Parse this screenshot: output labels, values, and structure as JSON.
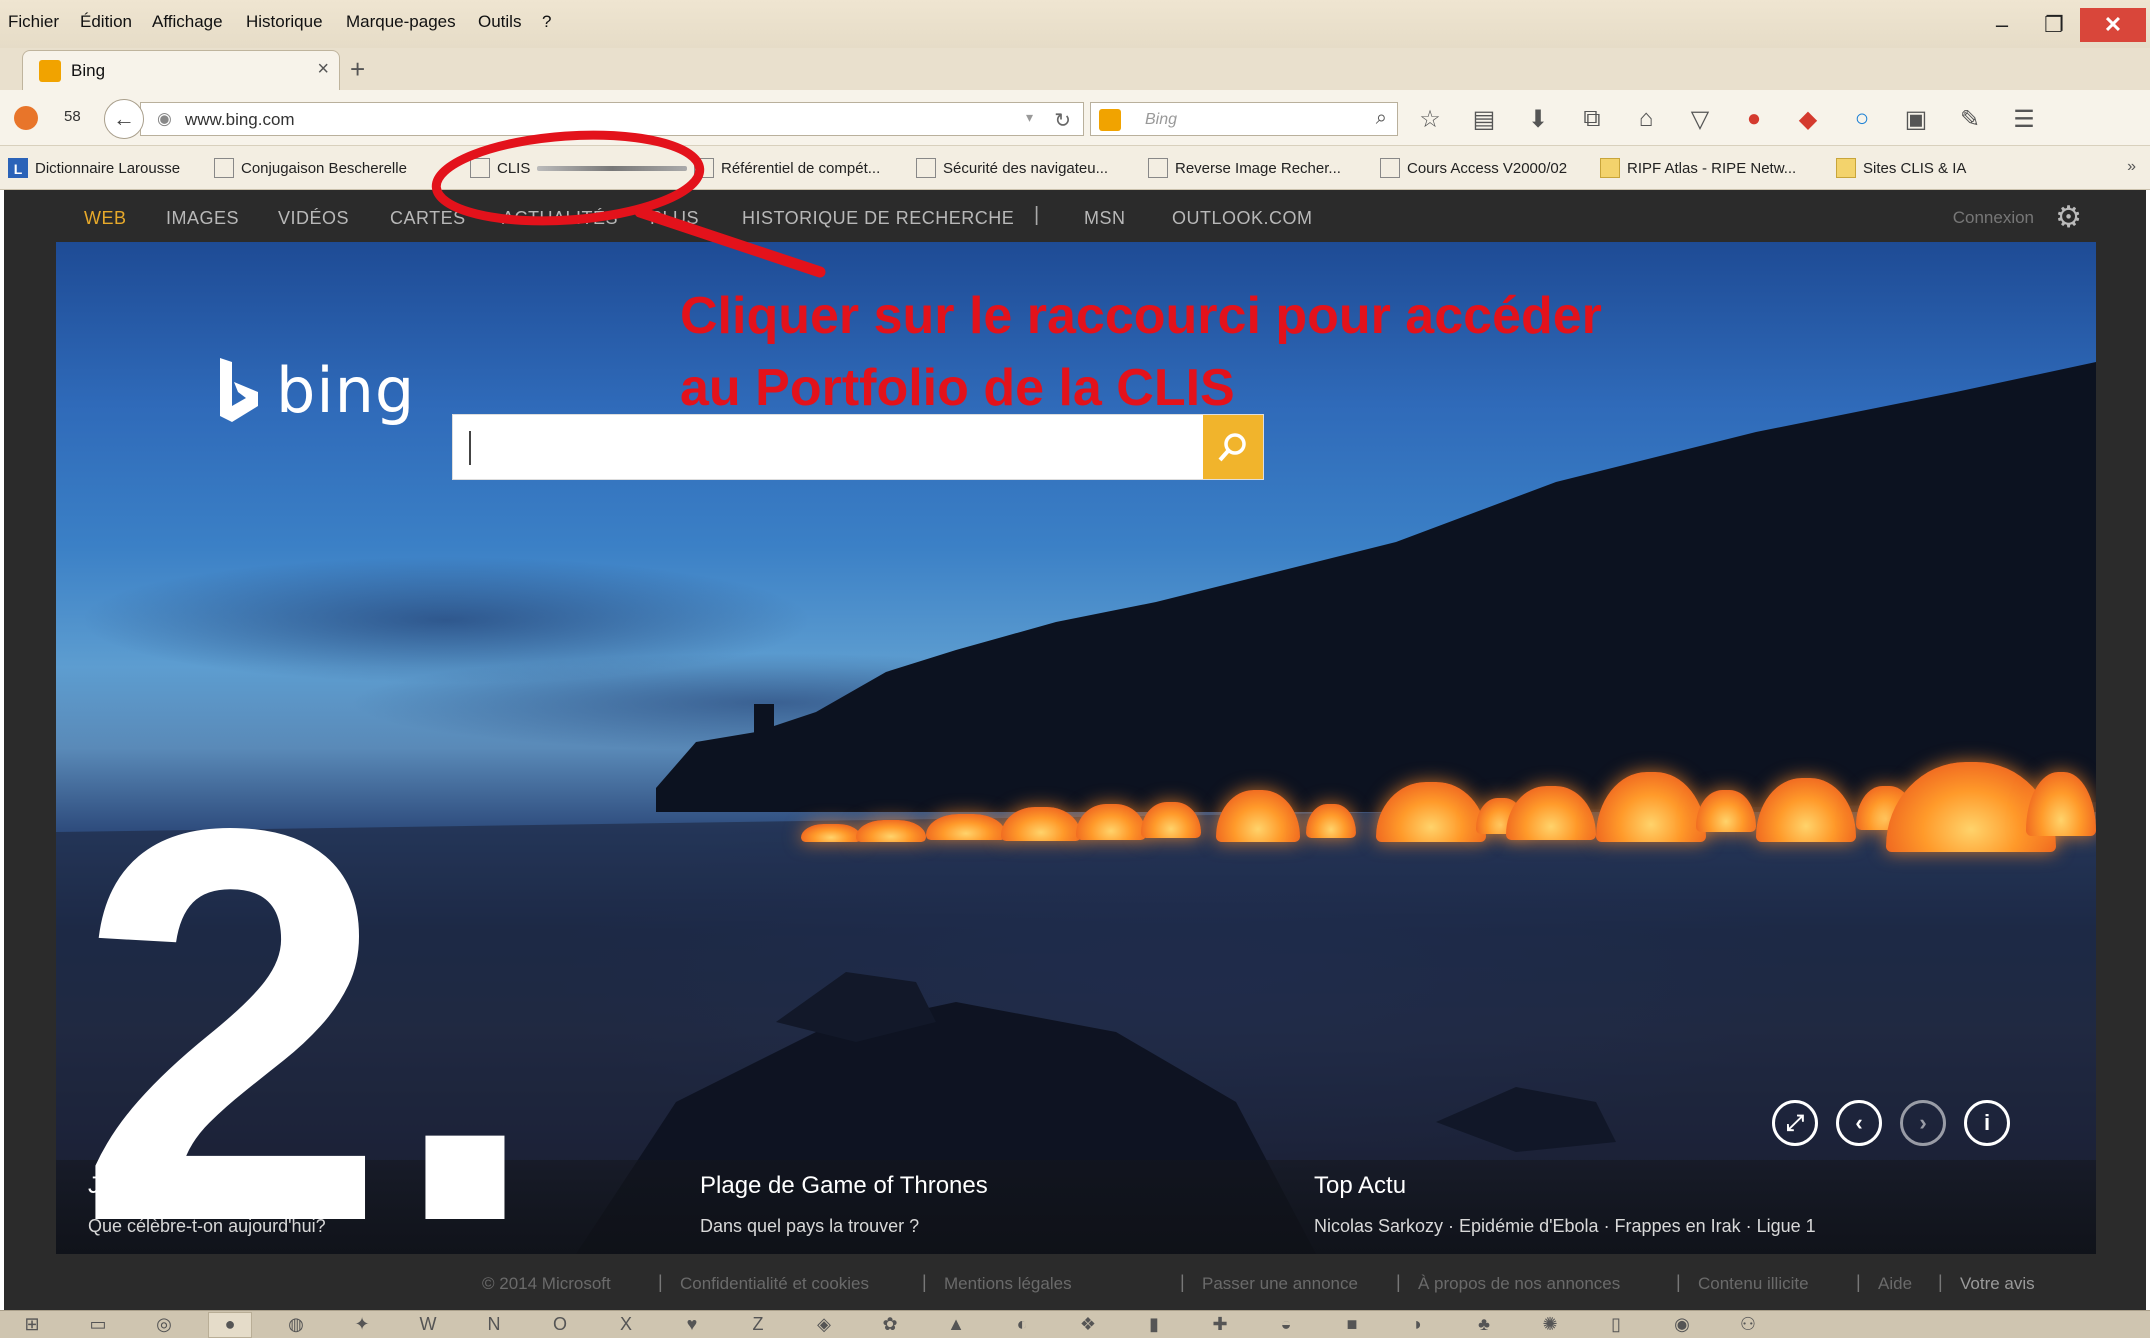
{
  "menubar": {
    "items": [
      "Fichier",
      "Édition",
      "Affichage",
      "Historique",
      "Marque-pages",
      "Outils",
      "?"
    ]
  },
  "tab": {
    "title": "Bing",
    "close": "×",
    "new_tab": "+"
  },
  "navbar": {
    "count": "58",
    "url": "www.bing.com",
    "search_placeholder": "Bing"
  },
  "bookmarks": [
    {
      "label": "Dictionnaire Larousse",
      "icon": "larousse-icon"
    },
    {
      "label": "Conjugaison Bescherelle",
      "icon": "page-icon"
    },
    {
      "label": "CLIS",
      "icon": "page-icon",
      "blurred": true
    },
    {
      "label": "Référentiel de compét...",
      "icon": "page-icon"
    },
    {
      "label": "Sécurité des navigateu...",
      "icon": "page-icon"
    },
    {
      "label": "Reverse Image Recher...",
      "icon": "image-icon"
    },
    {
      "label": "Cours Access V2000/02",
      "icon": "grid-icon"
    },
    {
      "label": "RIPF Atlas - RIPE Netw...",
      "icon": "folder-icon"
    },
    {
      "label": "Sites CLIS & IA",
      "icon": "folder-icon"
    }
  ],
  "bing": {
    "nav": [
      "WEB",
      "IMAGES",
      "VIDÉOS",
      "CARTES",
      "ACTUALITÉS",
      "PLUS",
      "HISTORIQUE DE RECHERCHE",
      "|",
      "MSN",
      "OUTLOOK.COM"
    ],
    "signin": "Connexion",
    "logo_text": "bing",
    "info": [
      {
        "title": "Jour",
        "subtitle": "Que célèbre-t-on aujourd'hui?"
      },
      {
        "title": "Plage de Game of Thrones",
        "subtitle": "Dans quel pays la trouver ?"
      },
      {
        "title": "Top Actu",
        "subtitle": "Nicolas Sarkozy · Epidémie d'Ebola · Frappes en Irak · Ligue 1"
      }
    ],
    "footer": [
      "© 2014 Microsoft",
      "Confidentialité et cookies",
      "Mentions légales",
      "Passer une annonce",
      "À propos de nos annonces",
      "Contenu illicite",
      "Aide",
      "Votre avis"
    ]
  },
  "annotation": {
    "line1": "Cliquer sur le raccourci pour accéder",
    "line2": "au Portfolio de la CLIS",
    "color": "#e3121b"
  },
  "overlay_number": "2.",
  "colors": {
    "accent_bing": "#f1b42c",
    "nav_active": "#e7a92a",
    "close_button": "#d9463a"
  }
}
